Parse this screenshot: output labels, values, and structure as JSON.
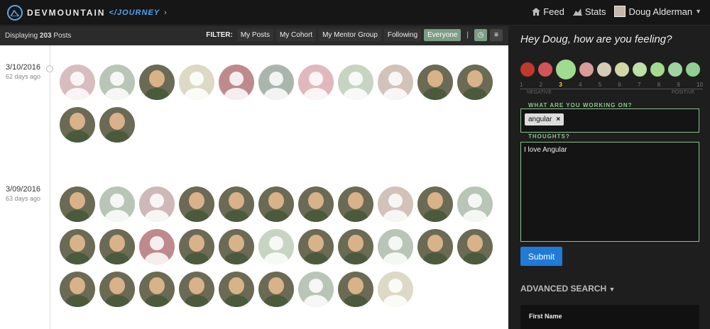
{
  "header": {
    "brand": "DEVMOUNTAIN",
    "journey": "</JOURNEY",
    "brand_chevron": "›",
    "nav": [
      {
        "label": "Feed",
        "icon": "home-icon"
      },
      {
        "label": "Stats",
        "icon": "chart-icon"
      }
    ],
    "user": "Doug Alderman"
  },
  "filterbar": {
    "displaying_prefix": "Displaying",
    "count": "203",
    "displaying_suffix": "Posts",
    "filter_label": "FILTER:",
    "buttons": [
      "My Posts",
      "My Cohort",
      "My Mentor Group",
      "Following",
      "Everyone"
    ],
    "active": "Everyone"
  },
  "feed": [
    {
      "date": "3/10/2016",
      "ago": "62 days ago"
    },
    {
      "date": "3/09/2016",
      "ago": "63 days ago"
    }
  ],
  "checkin": {
    "greeting": "Hey Doug, how are you feeling?",
    "scale": [
      "1",
      "2",
      "3",
      "4",
      "5",
      "6",
      "7",
      "8",
      "9",
      "10"
    ],
    "selected": "3",
    "negative": "NEGATIVE",
    "positive": "POSITIVE",
    "working_label": "WHAT ARE YOU WORKING ON?",
    "tag": "angular",
    "tag_remove": "×",
    "thoughts_label": "THOUGHTS?",
    "thoughts": "I love Angular",
    "submit": "Submit"
  },
  "advanced": {
    "label": "ADVANCED SEARCH",
    "first_name": "First Name"
  },
  "colors": {
    "accent": "#7c9e84",
    "submit": "#1f7ad8",
    "green_label": "#8bc38e"
  }
}
